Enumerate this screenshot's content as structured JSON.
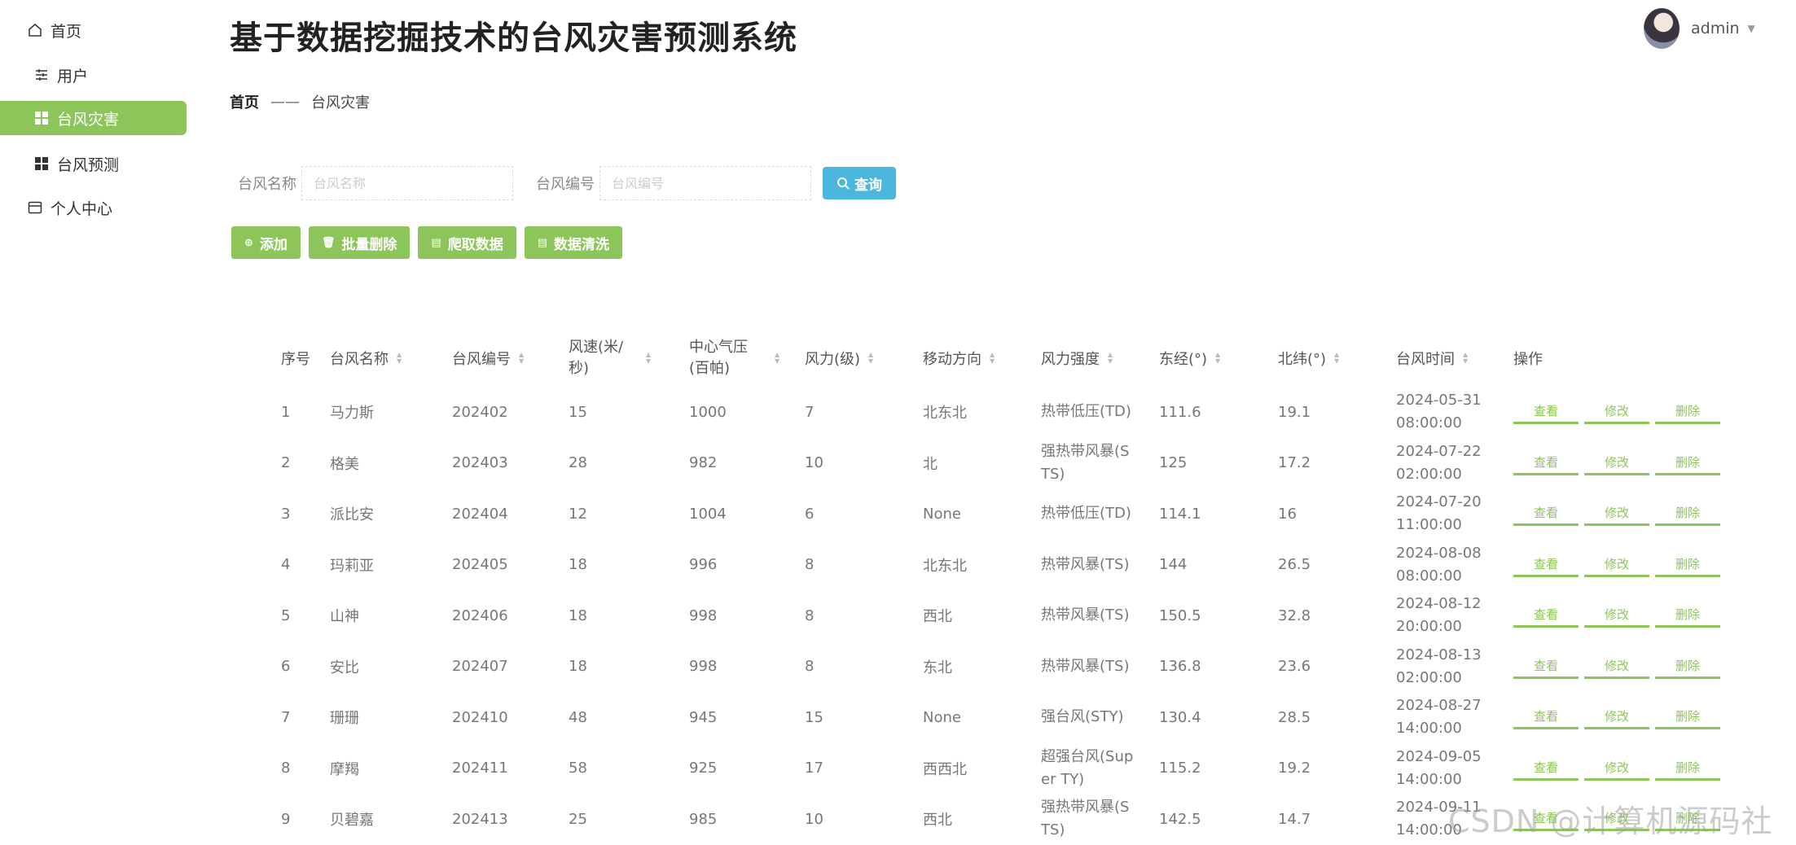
{
  "sidebar": {
    "items": [
      {
        "label": "首页"
      },
      {
        "label": "用户"
      },
      {
        "label": "台风灾害"
      },
      {
        "label": "台风预测"
      },
      {
        "label": "个人中心"
      }
    ]
  },
  "header": {
    "title": "基于数据挖掘技术的台风灾害预测系统",
    "user": "admin"
  },
  "breadcrumb": {
    "home": "首页",
    "separator": "——",
    "current": "台风灾害"
  },
  "search": {
    "name_label": "台风名称",
    "name_placeholder": "台风名称",
    "code_label": "台风编号",
    "code_placeholder": "台风编号",
    "query_label": "查询"
  },
  "actions": {
    "add": "添加",
    "batch_delete": "批量删除",
    "crawl": "爬取数据",
    "clean": "数据清洗"
  },
  "table": {
    "headers": [
      "序号",
      "台风名称",
      "台风编号",
      "风速(米/秒)",
      "中心气压(百帕)",
      "风力(级)",
      "移动方向",
      "风力强度",
      "东经(°)",
      "北纬(°)",
      "台风时间",
      "操作"
    ],
    "op_view": "查看",
    "op_edit": "修改",
    "op_delete": "删除",
    "rows": [
      {
        "idx": "1",
        "name": "马力斯",
        "code": "202402",
        "speed": "15",
        "pressure": "1000",
        "force": "7",
        "dir": "北东北",
        "level": "热带低压(TD)",
        "lon": "111.6",
        "lat": "19.1",
        "time": "2024-05-31 08:00:00"
      },
      {
        "idx": "2",
        "name": "格美",
        "code": "202403",
        "speed": "28",
        "pressure": "982",
        "force": "10",
        "dir": "北",
        "level": "强热带风暴(STS)",
        "lon": "125",
        "lat": "17.2",
        "time": "2024-07-22 02:00:00"
      },
      {
        "idx": "3",
        "name": "派比安",
        "code": "202404",
        "speed": "12",
        "pressure": "1004",
        "force": "6",
        "dir": "None",
        "level": "热带低压(TD)",
        "lon": "114.1",
        "lat": "16",
        "time": "2024-07-20 11:00:00"
      },
      {
        "idx": "4",
        "name": "玛莉亚",
        "code": "202405",
        "speed": "18",
        "pressure": "996",
        "force": "8",
        "dir": "北东北",
        "level": "热带风暴(TS)",
        "lon": "144",
        "lat": "26.5",
        "time": "2024-08-08 08:00:00"
      },
      {
        "idx": "5",
        "name": "山神",
        "code": "202406",
        "speed": "18",
        "pressure": "998",
        "force": "8",
        "dir": "西北",
        "level": "热带风暴(TS)",
        "lon": "150.5",
        "lat": "32.8",
        "time": "2024-08-12 20:00:00"
      },
      {
        "idx": "6",
        "name": "安比",
        "code": "202407",
        "speed": "18",
        "pressure": "998",
        "force": "8",
        "dir": "东北",
        "level": "热带风暴(TS)",
        "lon": "136.8",
        "lat": "23.6",
        "time": "2024-08-13 02:00:00"
      },
      {
        "idx": "7",
        "name": "珊珊",
        "code": "202410",
        "speed": "48",
        "pressure": "945",
        "force": "15",
        "dir": "None",
        "level": "强台风(STY)",
        "lon": "130.4",
        "lat": "28.5",
        "time": "2024-08-27 14:00:00"
      },
      {
        "idx": "8",
        "name": "摩羯",
        "code": "202411",
        "speed": "58",
        "pressure": "925",
        "force": "17",
        "dir": "西西北",
        "level": "超强台风(Super TY)",
        "lon": "115.2",
        "lat": "19.2",
        "time": "2024-09-05 14:00:00"
      },
      {
        "idx": "9",
        "name": "贝碧嘉",
        "code": "202413",
        "speed": "25",
        "pressure": "985",
        "force": "10",
        "dir": "西北",
        "level": "强热带风暴(STS)",
        "lon": "142.5",
        "lat": "14.7",
        "time": "2024-09-11 14:00:00"
      }
    ]
  },
  "watermark": "CSDN @计算机源码社",
  "colors": {
    "accent_green": "#8cc65a",
    "query_blue": "#4cb7dd"
  }
}
